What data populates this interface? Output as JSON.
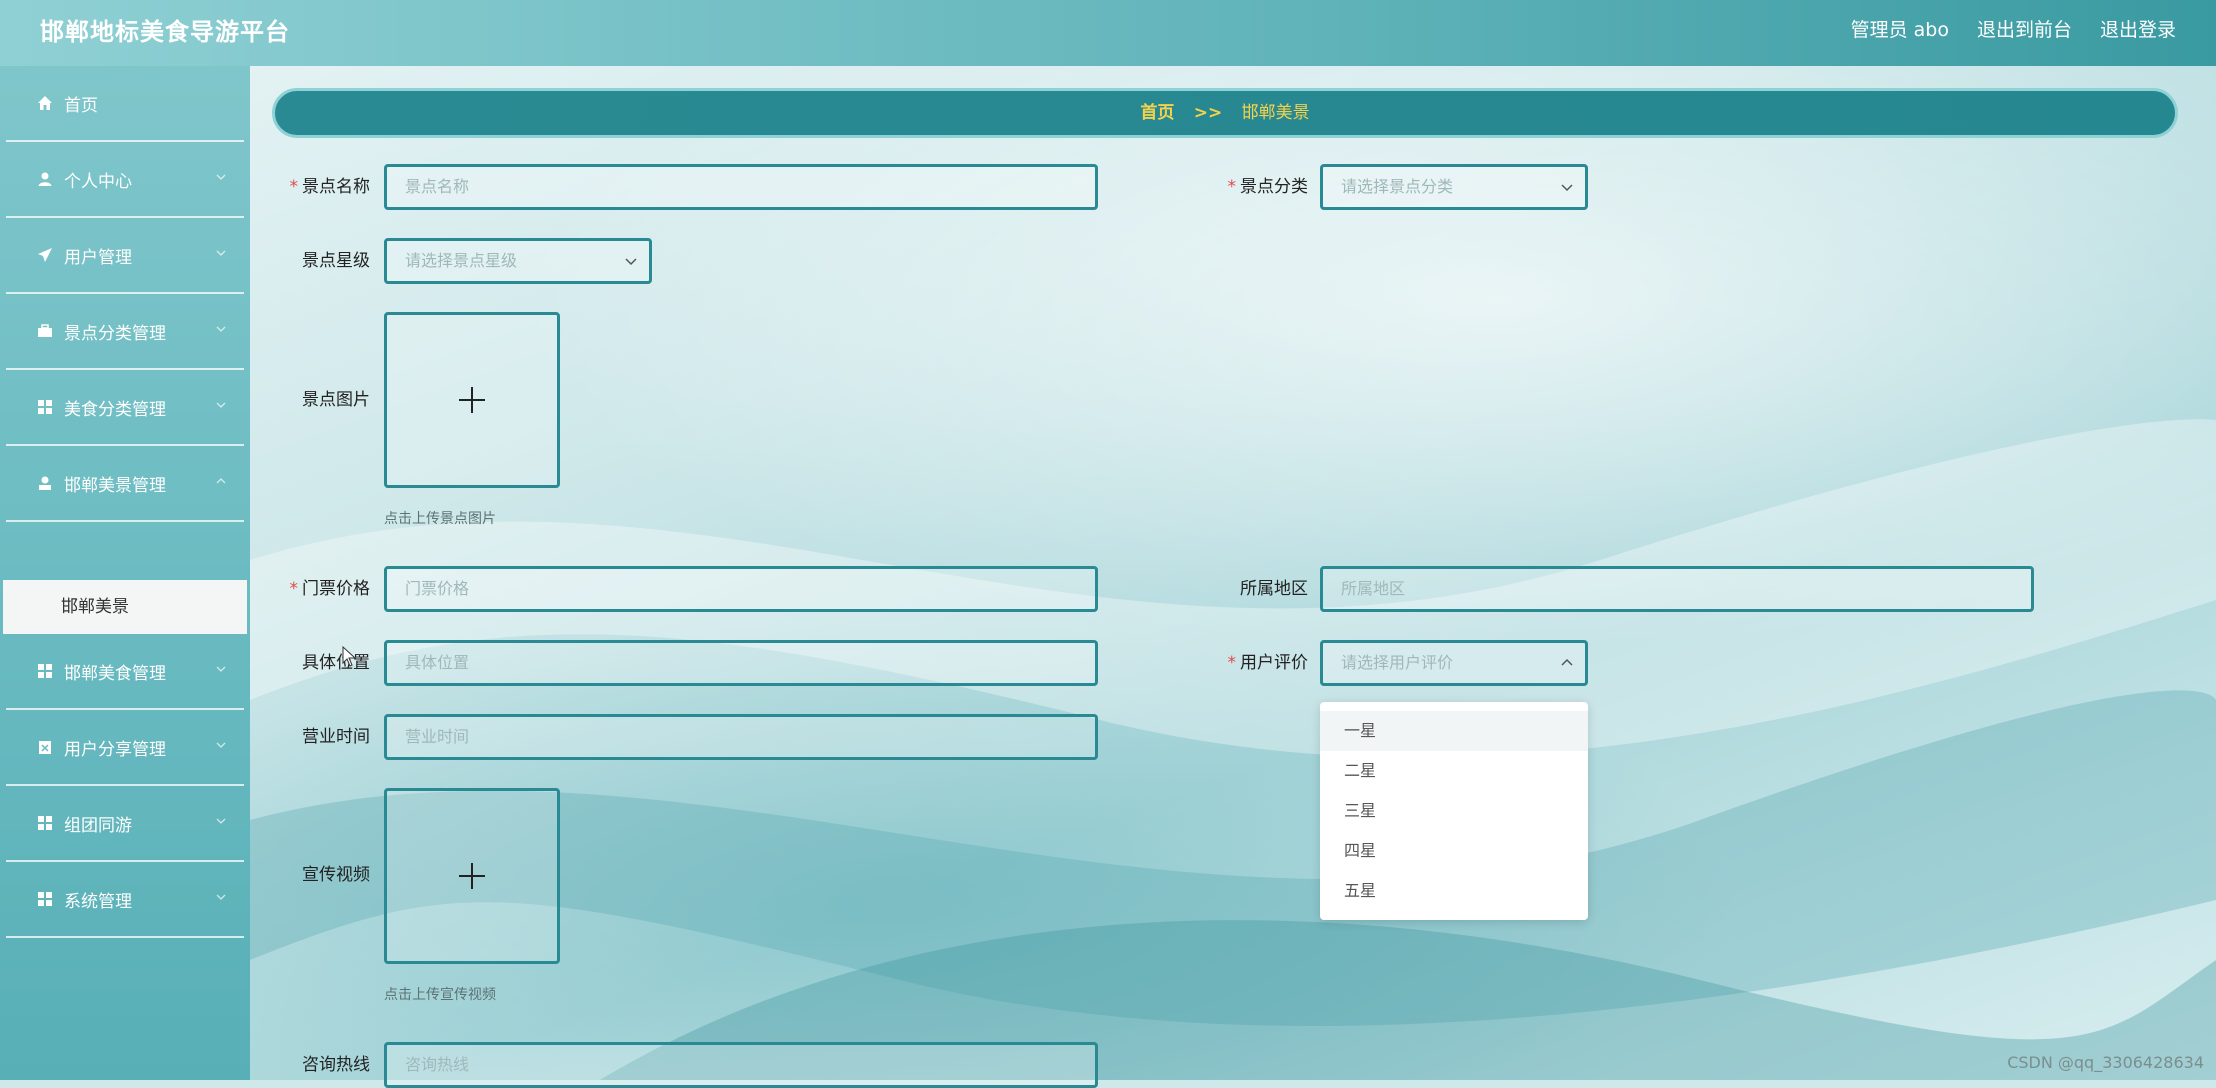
{
  "header": {
    "title": "邯郸地标美食导游平台",
    "admin": "管理员 abo",
    "front": "退出到前台",
    "logout": "退出登录"
  },
  "sidebar": {
    "items": [
      {
        "label": "首页",
        "icon": "home-icon"
      },
      {
        "label": "个人中心",
        "icon": "user-icon"
      },
      {
        "label": "用户管理",
        "icon": "paper-plane-icon"
      },
      {
        "label": "景点分类管理",
        "icon": "briefcase-icon"
      },
      {
        "label": "美食分类管理",
        "icon": "grid-icon"
      },
      {
        "label": "邯郸美景管理",
        "icon": "person-icon"
      },
      {
        "label": "邯郸美食管理",
        "icon": "grid-icon"
      },
      {
        "label": "用户分享管理",
        "icon": "clipboard-icon"
      },
      {
        "label": "组团同游",
        "icon": "grid-icon"
      },
      {
        "label": "系统管理",
        "icon": "grid-icon"
      }
    ],
    "submenu": "邯郸美景"
  },
  "breadcrumb": {
    "home": "首页",
    "sep": ">>",
    "current": "邯郸美景"
  },
  "form": {
    "name": {
      "label": "景点名称",
      "placeholder": "景点名称"
    },
    "category": {
      "label": "景点分类",
      "placeholder": "请选择景点分类"
    },
    "star": {
      "label": "景点星级",
      "placeholder": "请选择景点星级"
    },
    "image": {
      "label": "景点图片",
      "hint": "点击上传景点图片"
    },
    "price": {
      "label": "门票价格",
      "placeholder": "门票价格"
    },
    "region": {
      "label": "所属地区",
      "placeholder": "所属地区"
    },
    "location": {
      "label": "具体位置",
      "placeholder": "具体位置"
    },
    "rating": {
      "label": "用户评价",
      "placeholder": "请选择用户评价"
    },
    "hours": {
      "label": "营业时间",
      "placeholder": "营业时间"
    },
    "video": {
      "label": "宣传视频",
      "hint": "点击上传宣传视频"
    },
    "hotline": {
      "label": "咨询热线",
      "placeholder": "咨询热线"
    }
  },
  "dropdown": {
    "options": [
      "一星",
      "二星",
      "三星",
      "四星",
      "五星"
    ]
  },
  "watermark": "CSDN @qq_3306428634",
  "colors": {
    "accent": "#2a8a93",
    "breadcrumb_text": "#f3d34c",
    "required": "#e24b4b"
  }
}
